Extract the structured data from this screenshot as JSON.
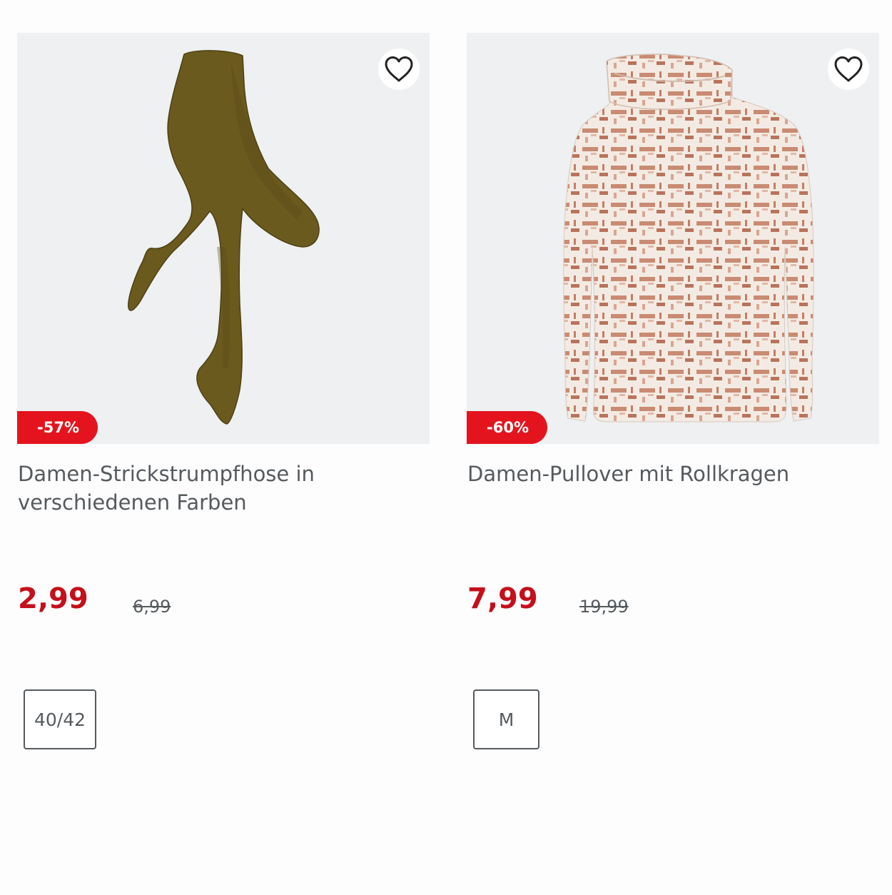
{
  "products": [
    {
      "badge": "-57%",
      "title": "Damen-Strickstrumpfhose in verschiedenen Farben",
      "price": "2,99",
      "old_price": "6,99",
      "size": "40/42",
      "image_icon": "tights-image",
      "wishlist_icon": "heart-icon"
    },
    {
      "badge": "-60%",
      "title": "Damen-Pullover mit Rollkragen",
      "price": "7,99",
      "old_price": "19,99",
      "size": "M",
      "image_icon": "sweater-image",
      "wishlist_icon": "heart-icon"
    }
  ],
  "colors": {
    "badge_bg": "#e3141e",
    "price": "#c4101b",
    "text": "#555a5e",
    "image_bg": "#eef0f2"
  }
}
